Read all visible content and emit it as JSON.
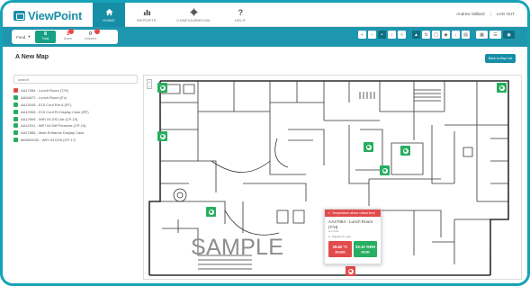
{
  "app": {
    "name": "ViewPoint"
  },
  "nav": {
    "tabs": [
      {
        "label": "HOME",
        "icon": "home-icon"
      },
      {
        "label": "REPORTS",
        "icon": "bar-chart-icon"
      },
      {
        "label": "CONFIGURATION",
        "icon": "gear-icon"
      },
      {
        "label": "HELP",
        "icon": "help-icon"
      }
    ],
    "user": "Andrew Stilliard",
    "logout": "LOG OUT"
  },
  "toolbar": {
    "dropdown": "Feed",
    "counters": [
      {
        "value": "8",
        "label": "Total"
      },
      {
        "value": "1",
        "label": "Alarm"
      },
      {
        "value": "0",
        "label": "Inhibited"
      }
    ]
  },
  "page": {
    "title": "A New Map",
    "back_button": "Back to Map List"
  },
  "search": {
    "placeholder": "search"
  },
  "devices": [
    {
      "name": "AA17084 - Lunch Room (T/H)",
      "status": "alarm"
    },
    {
      "name": "AA04872 - Lunch Room (Fz)",
      "status": "ok"
    },
    {
      "name": "AA13045 - E15 Conf Rm A (RT)",
      "status": "ok"
    },
    {
      "name": "AA12908 - E15 Conf Rt Display Case (RF)",
      "status": "ok"
    },
    {
      "name": "AA12909 - WiFi 04 DS1 Air (CP-15)",
      "status": "ok"
    },
    {
      "name": "AA12911 - WiFi 04 Diff Pressure (CP-15)",
      "status": "ok"
    },
    {
      "name": "AA17885 - Main Entrance Display Case",
      "status": "ok"
    },
    {
      "name": "MM000033 - WiFi 04 DS5 (CP-17)",
      "status": "ok"
    }
  ],
  "map": {
    "watermark": "SAMPLE"
  },
  "popup": {
    "header": "Temperature above critical level",
    "title": "AA17084 - Lunch Room (T/H)",
    "subtitle": "last data",
    "location": "Sample Pt. type",
    "readings": [
      {
        "value": "28.62 °C",
        "tag": "20 - 24.5"
      },
      {
        "value": "33.10 %RH",
        "tag": "20 - 60"
      }
    ]
  },
  "colors": {
    "brand": "#168ea6",
    "toolbar": "#1e97ae",
    "ok": "#27ae60",
    "alarm": "#e24b4b",
    "frame": "#15a2b8"
  }
}
